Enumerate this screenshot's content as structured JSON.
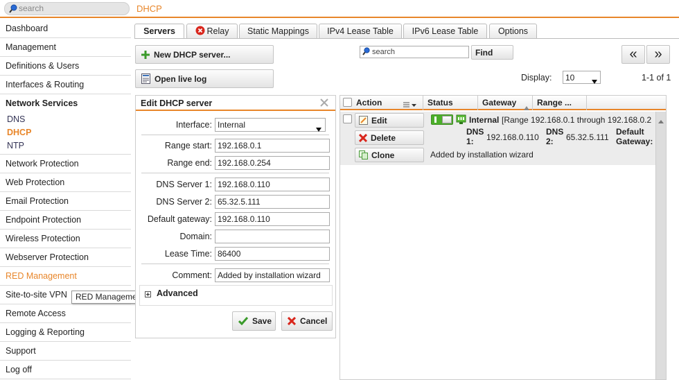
{
  "top": {
    "search_placeholder": "search",
    "breadcrumb": "DHCP"
  },
  "sidebar": {
    "items": [
      "Dashboard",
      "Management",
      "Definitions & Users",
      "Interfaces & Routing"
    ],
    "section": "Network Services",
    "sub": [
      "DNS",
      "DHCP",
      "NTP"
    ],
    "items2": [
      "Network Protection",
      "Web Protection",
      "Email Protection",
      "Endpoint Protection",
      "Wireless Protection",
      "Webserver Protection",
      "RED Management",
      "Site-to-site VPN",
      "Remote Access",
      "Logging & Reporting",
      "Support",
      "Log off"
    ]
  },
  "tooltip": "RED Management",
  "tabs": [
    "Servers",
    "Relay",
    "Static Mappings",
    "IPv4 Lease Table",
    "IPv6 Lease Table",
    "Options"
  ],
  "toolbar": {
    "new_server": "New DHCP server...",
    "open_log": "Open live log",
    "search_placeholder": "search",
    "find": "Find",
    "prev": "«",
    "next": "»",
    "display_label": "Display:",
    "display_value": "10",
    "count": "1-1 of 1"
  },
  "edit": {
    "title": "Edit DHCP server",
    "interface_label": "Interface:",
    "interface_value": "Internal",
    "range_start_label": "Range start:",
    "range_start": "192.168.0.1",
    "range_end_label": "Range end:",
    "range_end": "192.168.0.254",
    "dns1_label": "DNS Server 1:",
    "dns1": "192.168.0.110",
    "dns2_label": "DNS Server 2:",
    "dns2": "65.32.5.111",
    "gw_label": "Default gateway:",
    "gw": "192.168.0.110",
    "domain_label": "Domain:",
    "domain": "",
    "lease_label": "Lease Time:",
    "lease": "86400",
    "comment_label": "Comment:",
    "comment": "Added by installation wizard",
    "advanced": "Advanced",
    "save": "Save",
    "cancel": "Cancel"
  },
  "grid": {
    "headers": [
      "Action",
      "Status",
      "Gateway",
      "Range ..."
    ],
    "row": {
      "edit": "Edit",
      "delete": "Delete",
      "clone": "Clone",
      "name": "Internal",
      "range": "[Range 192.168.0.1 through 192.168.0.2",
      "dns1_label": "DNS 1:",
      "dns1": "192.168.0.110",
      "dns2_label": "DNS 2:",
      "dns2": "65.32.5.111",
      "gw_label": "Default Gateway:",
      "comment": "Added by installation wizard"
    }
  },
  "colors": {
    "accent": "#e8862a",
    "toggle_on": "#4caf2a"
  }
}
